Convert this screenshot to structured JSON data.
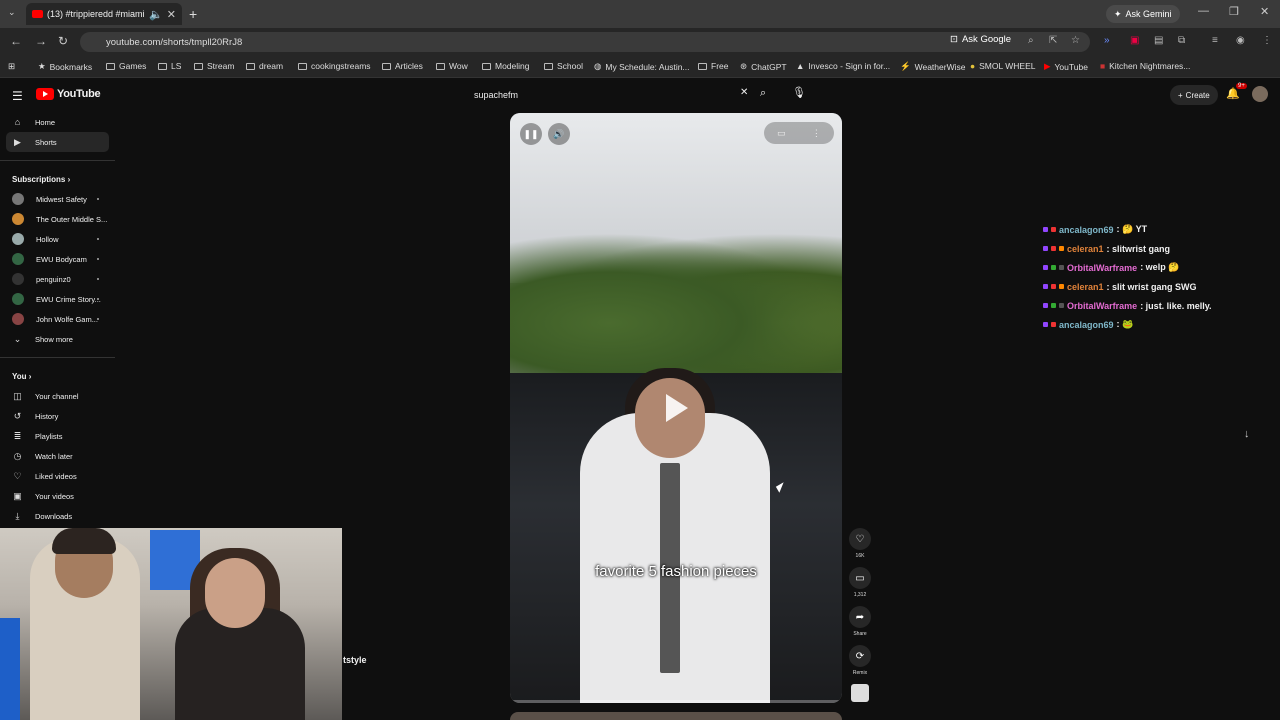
{
  "browser": {
    "tab_title": "(13) #trippieredd #miami #",
    "url": "youtube.com/shorts/tmpll20RrJ8",
    "ask_gemini": "Ask Gemini",
    "ask_google": "Ask Google",
    "bookmarks": [
      "Bookmarks",
      "Games",
      "LS",
      "Stream",
      "dream",
      "cookingstreams",
      "Articles",
      "Wow",
      "Modeling",
      "School",
      "My Schedule: Austin...",
      "Free",
      "ChatGPT",
      "Invesco - Sign in for...",
      "WeatherWise",
      "SMOL WHEEL",
      "YouTube",
      "Kitchen Nightmares..."
    ]
  },
  "youtube": {
    "logo": "YouTube",
    "search_value": "supachefm",
    "create_label": "Create",
    "notif_count": "9+"
  },
  "sidebar": {
    "nav": [
      {
        "label": "Home",
        "icon": "home-icon"
      },
      {
        "label": "Shorts",
        "icon": "shorts-icon"
      }
    ],
    "subscriptions_label": "Subscriptions",
    "subscriptions": [
      "Midwest Safety",
      "The Outer Middle S...",
      "Hollow",
      "EWU Bodycam",
      "penguinz0",
      "EWU Crime Story...",
      "John Wolfe Gam..."
    ],
    "show_more": "Show more",
    "you_label": "You",
    "you_items": [
      {
        "label": "Your channel",
        "icon": "channel-icon"
      },
      {
        "label": "History",
        "icon": "history-icon"
      },
      {
        "label": "Playlists",
        "icon": "playlist-icon"
      },
      {
        "label": "Watch later",
        "icon": "clock-icon"
      },
      {
        "label": "Liked videos",
        "icon": "like-icon"
      },
      {
        "label": "Your videos",
        "icon": "video-icon"
      },
      {
        "label": "Downloads",
        "icon": "download-icon"
      }
    ]
  },
  "short": {
    "caption": "favorite 5 fashion pieces",
    "likes": "16K",
    "comments": "1,312",
    "share": "Share",
    "remix": "Remix",
    "progress": 0.0
  },
  "overlay_text": "tstyle",
  "chat": [
    {
      "user": "ancalagon69",
      "text": " : 🤔 YT",
      "color": "#7fb7c9"
    },
    {
      "user": "celeran1",
      "text": " : slitwrist gang",
      "color": "#e0823a"
    },
    {
      "user": "OrbitalWarframe",
      "text": " : welp 🤔",
      "color": "#e36bd1"
    },
    {
      "user": "celeran1",
      "text": " : slit wrist gang SWG",
      "color": "#e0823a"
    },
    {
      "user": "OrbitalWarframe",
      "text": " : just. like. melly.",
      "color": "#e36bd1"
    },
    {
      "user": "ancalagon69",
      "text": " : 🐸",
      "color": "#7fb7c9"
    }
  ]
}
